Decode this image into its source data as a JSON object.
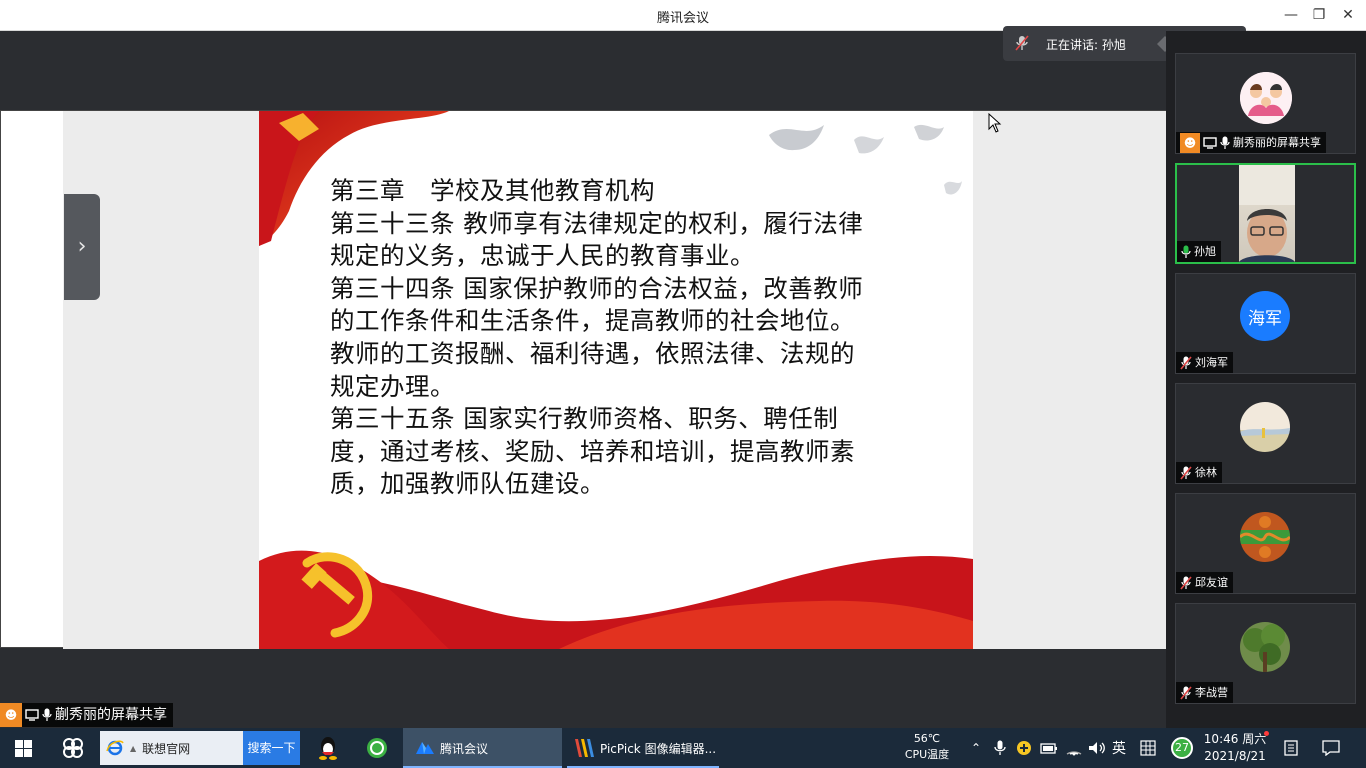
{
  "window": {
    "title": "腾讯会议",
    "minimize_glyph": "—",
    "restore_glyph": "❐",
    "close_glyph": "✕"
  },
  "speaking": {
    "label": "正在讲话: 孙旭"
  },
  "slide": {
    "lines": [
      "第三章　学校及其他教育机构",
      "第三十三条 教师享有法律规定的权利，履行法律",
      "规定的义务，忠诚于人民的教育事业。",
      "第三十四条 国家保护教师的合法权益，改善教师",
      "的工作条件和生活条件，提高教师的社会地位。",
      "教师的工资报酬、福利待遇，依照法律、法规的",
      "规定办理。",
      "第三十五条 国家实行教师资格、职务、聘任制",
      "度，通过考核、奖励、培养和培训，提高教师素",
      "质，加强教师队伍建设。"
    ]
  },
  "sidebar_toggle_glyph": "›",
  "participants": [
    {
      "name": "蒯秀丽的屏幕共享",
      "avatar": "cartoon-family-avatar",
      "mic": "on",
      "sharing": true
    },
    {
      "name": "孙旭",
      "avatar": "video-feed",
      "mic": "on",
      "active": true
    },
    {
      "name": "刘海军",
      "avatar_text": "海军",
      "avatar_color": "#1a7cff",
      "mic": "muted"
    },
    {
      "name": "徐林",
      "avatar": "landscape-avatar",
      "mic": "muted"
    },
    {
      "name": "邱友谊",
      "avatar": "flower-avatar",
      "mic": "muted"
    },
    {
      "name": "李战营",
      "avatar": "tree-avatar",
      "mic": "muted"
    }
  ],
  "share_label": "蒯秀丽的屏幕共享",
  "taskbar": {
    "search_text": "联想官网",
    "search_button": "搜索一下",
    "apps": [
      {
        "label": "腾讯会议",
        "icon": "tencent-meeting-icon"
      },
      {
        "label": "PicPick 图像编辑器...",
        "icon": "picpick-icon"
      }
    ],
    "temp_value": "56℃",
    "temp_label": "CPU温度",
    "ime": "英",
    "notif_count": "27",
    "time": "10:46 周六",
    "date": "2021/8/21"
  },
  "colors": {
    "accent_green": "#2bbf4a",
    "tencent_blue": "#1a7cff",
    "taskbar_bg": "#1b2a3a"
  }
}
